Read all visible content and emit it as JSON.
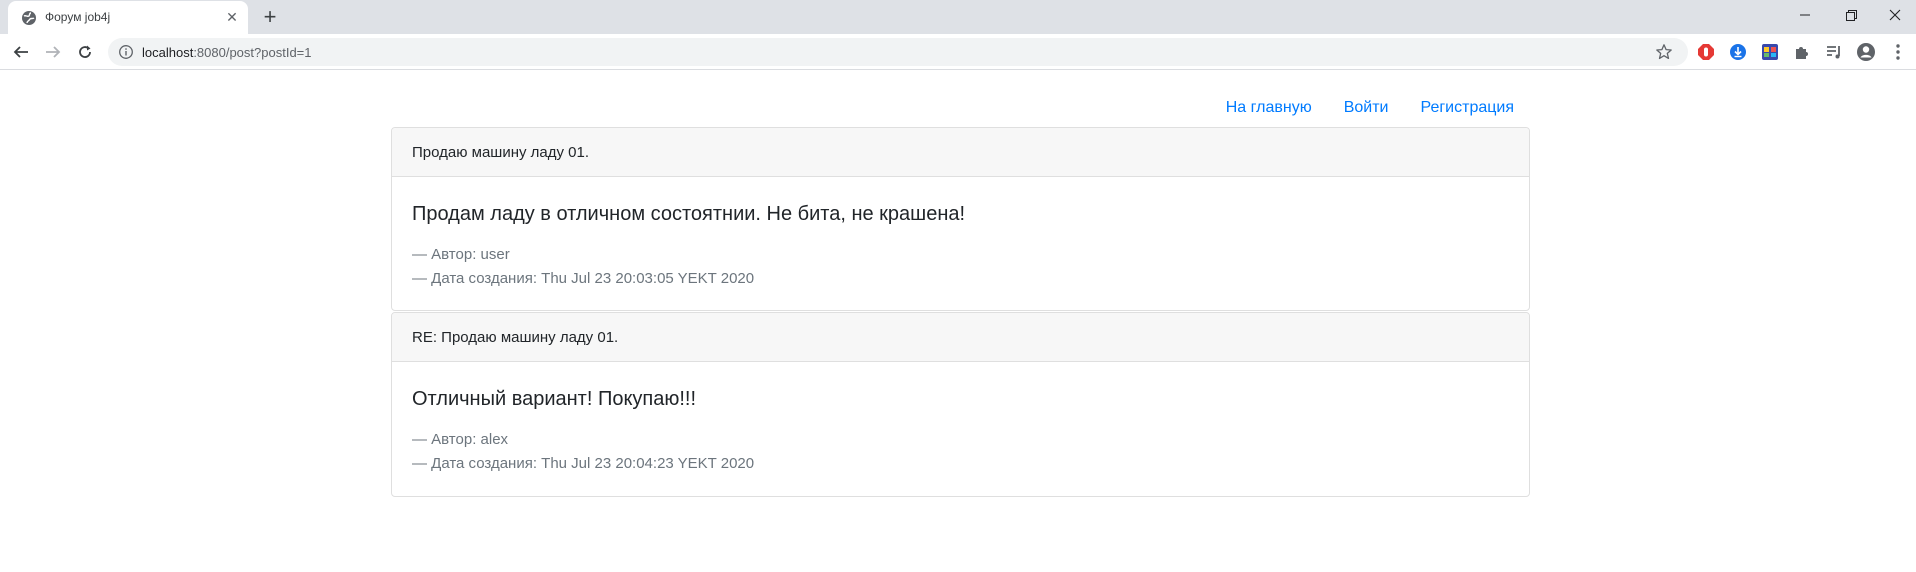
{
  "browser": {
    "tab_title": "Форум job4j",
    "url_host": "localhost",
    "url_path": ":8080/post?postId=1"
  },
  "nav": {
    "home": "На главную",
    "login": "Войти",
    "register": "Регистрация"
  },
  "posts": [
    {
      "header": "Продаю машину ладу 01.",
      "text": "Продам ладу в отличном состоятнии. Не бита, не крашена!",
      "author": "— Автор: user",
      "created": "— Дата создания: Thu Jul 23 20:03:05 YEKT 2020"
    },
    {
      "header": "RE: Продаю машину ладу 01.",
      "text": "Отличный вариант! Покупаю!!!",
      "author": "— Автор: alex",
      "created": "— Дата создания: Thu Jul 23 20:04:23 YEKT 2020"
    }
  ],
  "colors": {
    "link": "#007bff",
    "header_bg": "#f7f7f7",
    "muted": "#6c757d"
  }
}
